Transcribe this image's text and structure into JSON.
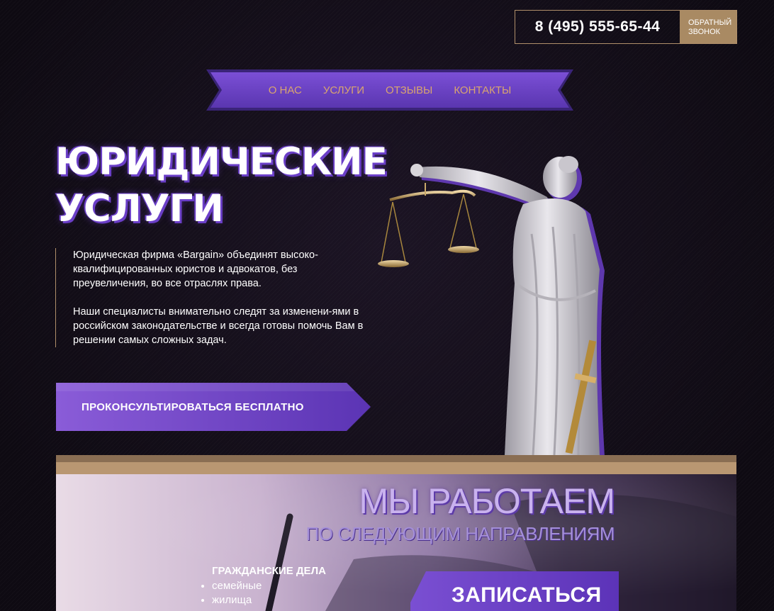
{
  "header": {
    "phone": "8 (495) 555-65-44",
    "callback_label_1": "ОБРАТНЫЙ",
    "callback_label_2": "ЗВОНОК"
  },
  "nav": {
    "items": [
      {
        "label": "О НАС"
      },
      {
        "label": "УСЛУГИ"
      },
      {
        "label": "ОТЗЫВЫ"
      },
      {
        "label": "КОНТАКТЫ"
      }
    ]
  },
  "hero": {
    "title_line1": "ЮРИДИЧЕСКИЕ",
    "title_line2": "УСЛУГИ",
    "paragraph1": "Юридическая фирма «Bargain» объединят высоко-квалифицированных юристов и адвокатов, без преувеличения, во все отраслях права.",
    "paragraph2": "Наши специалисты внимательно следят за изменени-ями в российском законодательстве и всегда готовы помочь Вам в решении самых сложных задач.",
    "cta_label": "ПРОКОНСУЛЬТИРОВАТЬСЯ БЕСПЛАТНО"
  },
  "works": {
    "title": "МЫ РАБОТАЕМ",
    "subtitle": "ПО СЛЕДУЮЩИМ НАПРАВЛЕНИЯМ",
    "civil_title": "ГРАЖДАНСКИЕ ДЕЛА",
    "civil_items": [
      "семейные",
      "жилища"
    ],
    "signup_label": "ЗАПИСАТЬСЯ"
  },
  "colors": {
    "accent_purple": "#6b3fc8",
    "accent_gold": "#b08f6a",
    "nav_text": "#d9a56f"
  }
}
